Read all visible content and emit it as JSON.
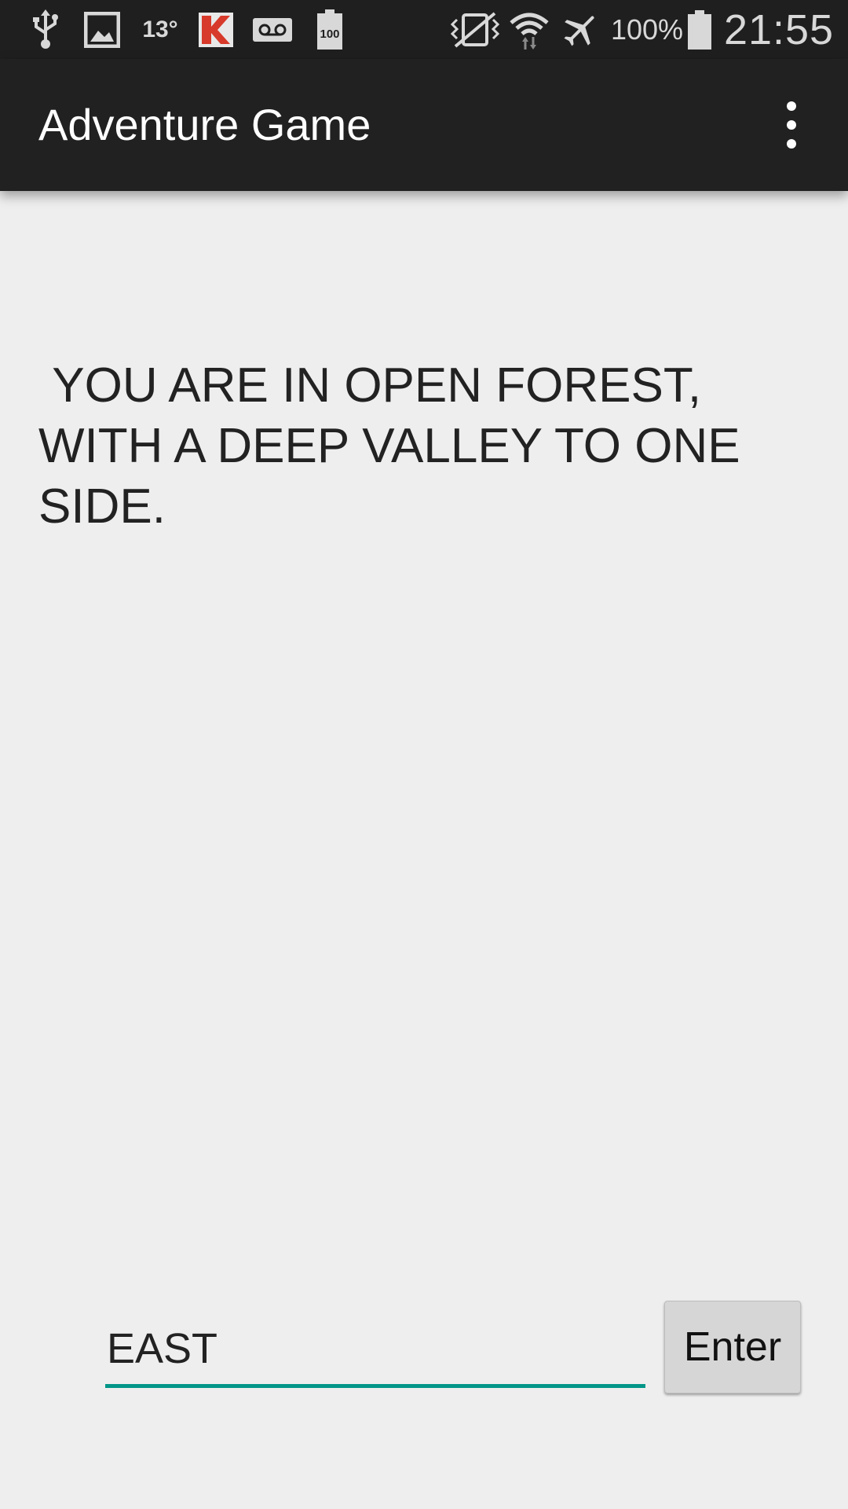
{
  "status_bar": {
    "icons_left": [
      "usb-icon",
      "gallery-icon",
      "kaspersky-icon",
      "voicemail-icon",
      "battery-100-icon"
    ],
    "temperature": "13°",
    "battery_badge": "100",
    "icons_right": [
      "vibrate-icon",
      "wifi-icon",
      "airplane-mode-icon",
      "battery-icon"
    ],
    "battery_percent": "100%",
    "time": "21:55"
  },
  "app_bar": {
    "title": "Adventure Game",
    "menu_icon": "more-vert-icon"
  },
  "main": {
    "room_description": " YOU ARE IN OPEN FOREST,\nWITH A DEEP VALLEY TO ONE\nSIDE."
  },
  "input_row": {
    "command_value": "EAST",
    "enter_label": "Enter"
  },
  "colors": {
    "status_bar_bg": "#1f1f1f",
    "app_bar_bg": "#212121",
    "background": "#eeeeee",
    "accent": "#009688",
    "button_bg": "#d6d6d6"
  }
}
